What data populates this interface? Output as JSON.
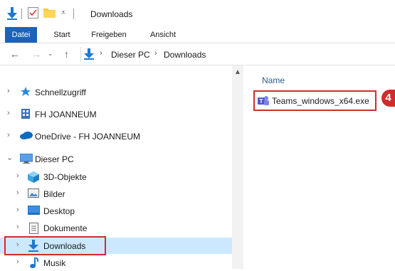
{
  "window": {
    "title": "Downloads"
  },
  "ribbon": {
    "tabs": [
      {
        "label": "Datei",
        "active": true
      },
      {
        "label": "Start"
      },
      {
        "label": "Freigeben"
      },
      {
        "label": "Ansicht"
      }
    ]
  },
  "address": {
    "breadcrumbs": [
      "Dieser PC",
      "Downloads"
    ],
    "separator": "›"
  },
  "navigation": {
    "items": [
      {
        "label": "Schnellzugriff",
        "icon": "star-icon",
        "expanded": false
      },
      {
        "label": "FH JOANNEUM",
        "icon": "building-icon",
        "expanded": false
      },
      {
        "label": "OneDrive - FH JOANNEUM",
        "icon": "cloud-icon",
        "expanded": false
      },
      {
        "label": "Dieser PC",
        "icon": "computer-icon",
        "expanded": true
      },
      {
        "label": "3D-Objekte",
        "icon": "cube-icon",
        "expanded": false
      },
      {
        "label": "Bilder",
        "icon": "pictures-icon",
        "expanded": false
      },
      {
        "label": "Desktop",
        "icon": "desktop-icon",
        "expanded": false
      },
      {
        "label": "Dokumente",
        "icon": "document-icon",
        "expanded": false
      },
      {
        "label": "Downloads",
        "icon": "download-arrow-icon",
        "expanded": false,
        "selected": true
      },
      {
        "label": "Musik",
        "icon": "music-icon",
        "expanded": false
      }
    ]
  },
  "content": {
    "column_header": "Name",
    "files": [
      {
        "name": "Teams_windows_x64.exe",
        "icon": "teams-icon"
      }
    ]
  },
  "annotation": {
    "step": "4"
  },
  "colors": {
    "accent": "#1a63b8",
    "highlight": "#d22b2b",
    "selection": "#cce8ff"
  }
}
